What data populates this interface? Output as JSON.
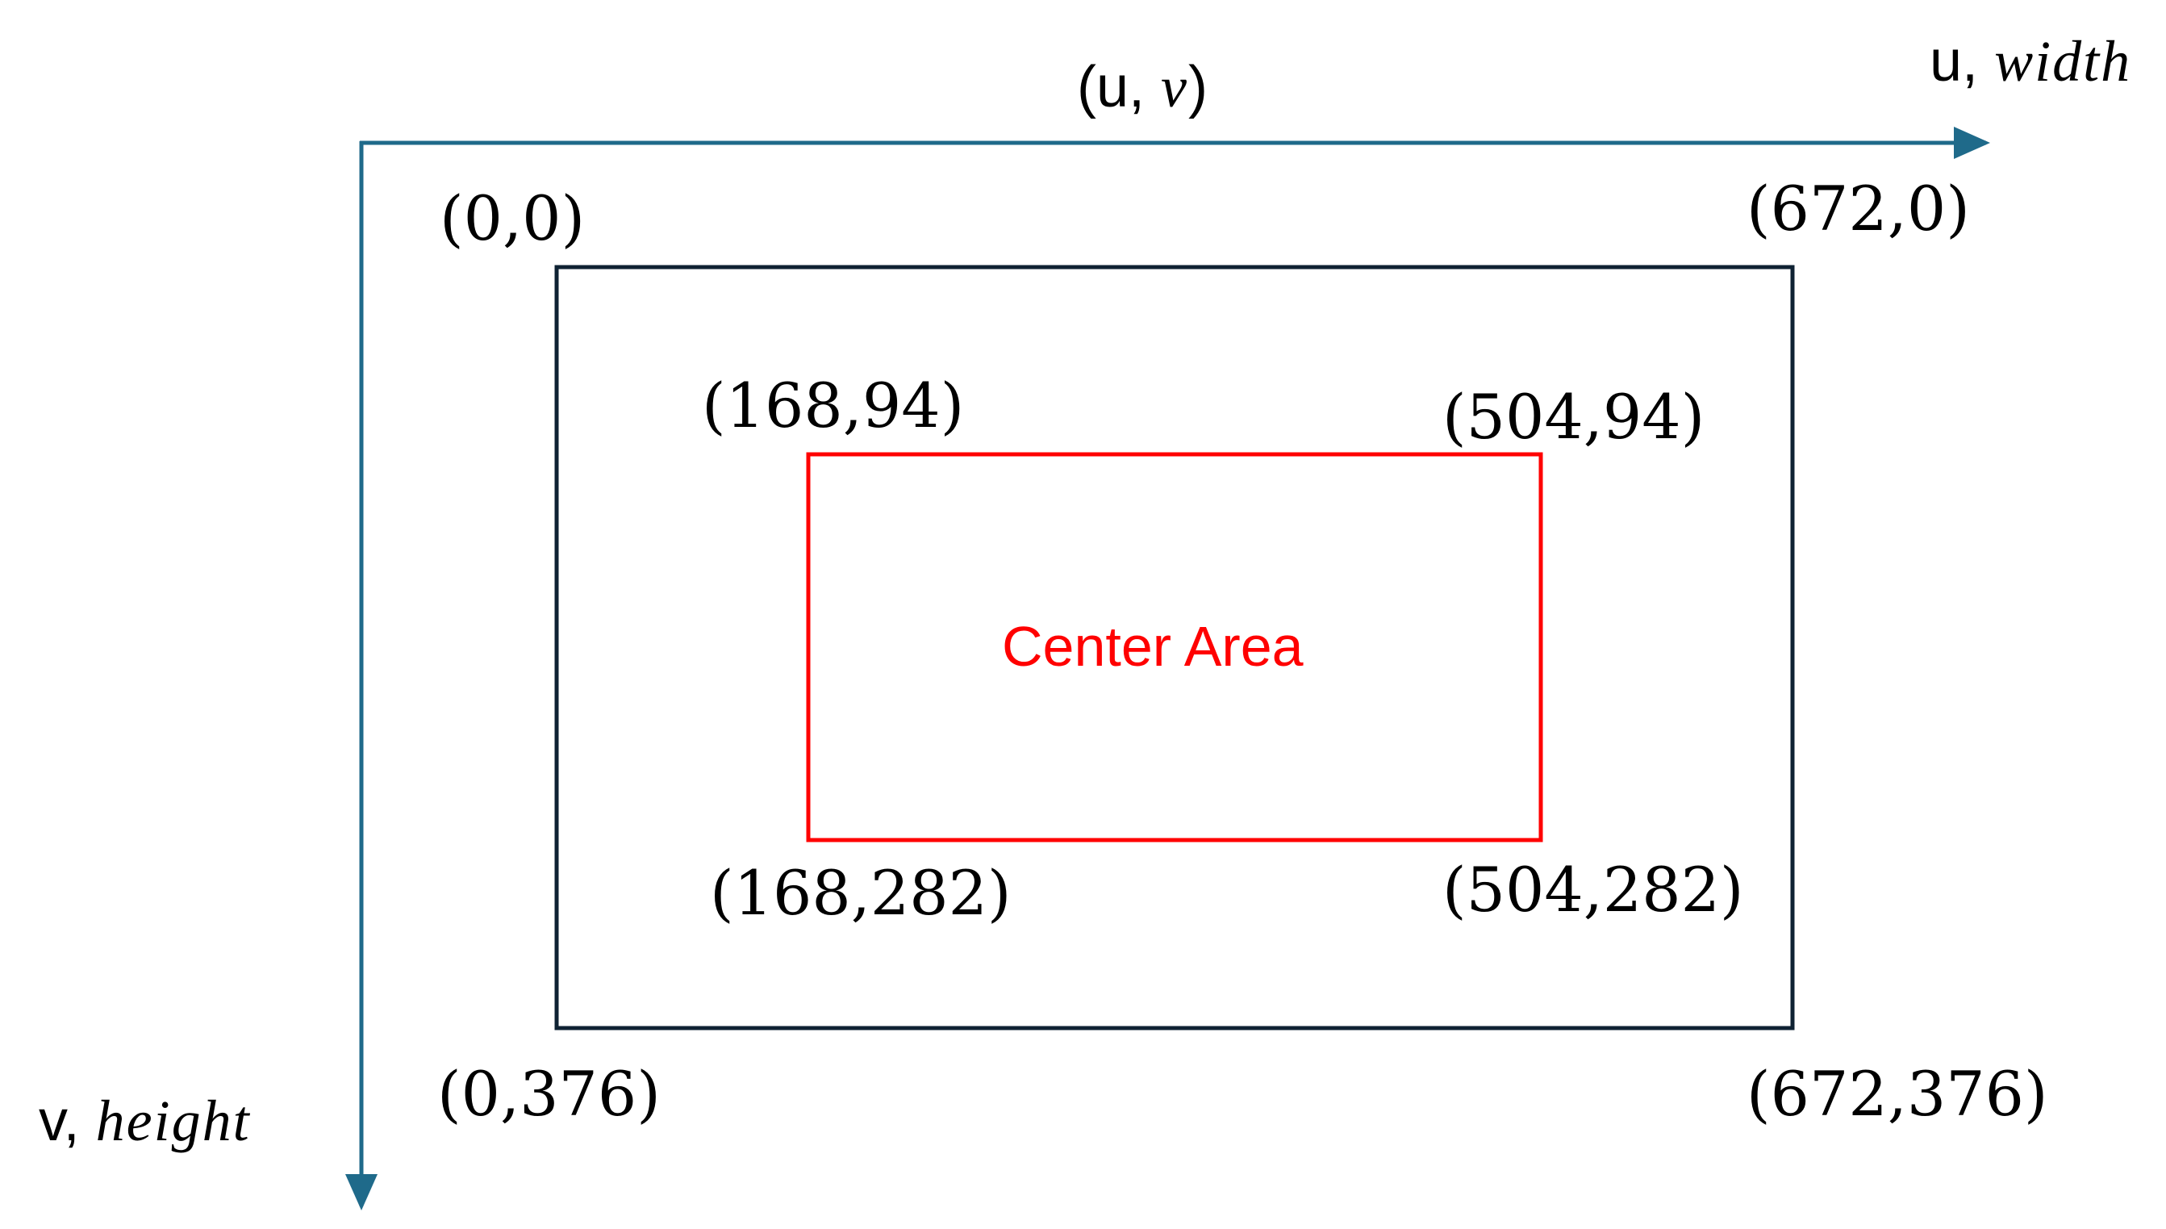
{
  "colors": {
    "axis": "#1f6a8a",
    "outer_frame": "#0f2233",
    "center_area": "#ff0000",
    "text": "#000000"
  },
  "axes": {
    "top_label": {
      "prefix": "(u, ",
      "var": "v",
      "suffix": ")"
    },
    "u_axis_label": {
      "prefix": "u, ",
      "var": "width"
    },
    "v_axis_label": {
      "prefix": "v, ",
      "var": "height"
    }
  },
  "image_frame": {
    "corners": {
      "top_left": "(0,0)",
      "top_right": "(672,0)",
      "bottom_left": "(0,376)",
      "bottom_right": "(672,376)"
    }
  },
  "center_area": {
    "label": "Center Area",
    "corners": {
      "top_left": "(168,94)",
      "top_right": "(504,94)",
      "bottom_left": "(168,282)",
      "bottom_right": "(504,282)"
    }
  }
}
